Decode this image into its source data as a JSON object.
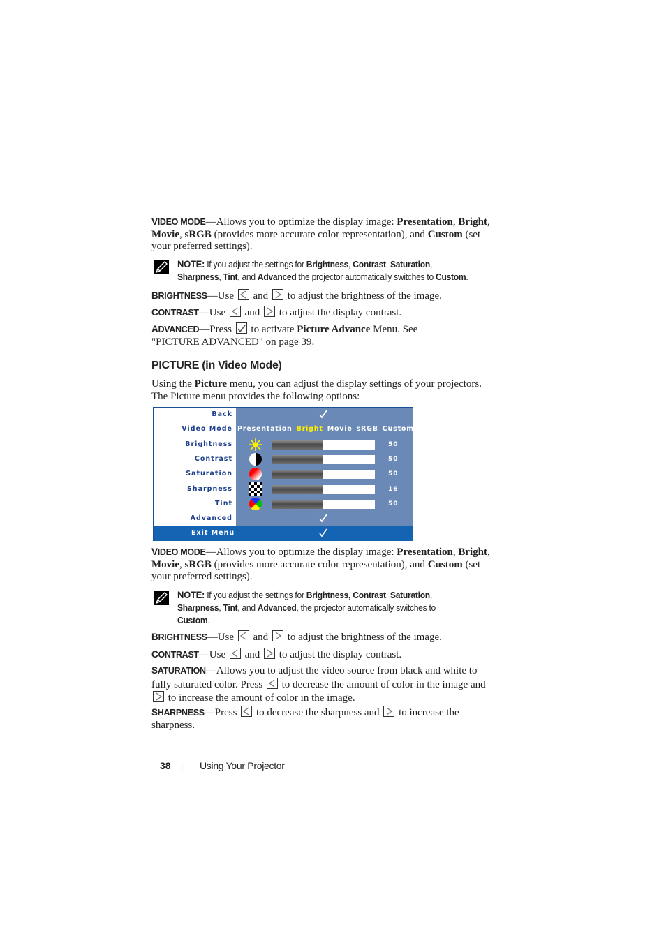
{
  "section1": {
    "video_mode": [
      {
        "sc": "Video mode"
      },
      {
        "t": "—Allows you to optimize the display image: "
      },
      {
        "b": "Presentation"
      },
      {
        "t": ", "
      },
      {
        "b": "Bright"
      },
      {
        "t": ", "
      },
      {
        "b": "Movie"
      },
      {
        "t": ", "
      },
      {
        "b": "sRGB"
      },
      {
        "t": " (provides more accurate color representation), and "
      },
      {
        "b": "Custom"
      },
      {
        "t": " (set your preferred settings)."
      }
    ],
    "note": [
      {
        "lead": "NOTE:"
      },
      {
        "t": " If you adjust the settings for "
      },
      {
        "b": "Brightness"
      },
      {
        "t": ", "
      },
      {
        "b": "Contrast"
      },
      {
        "t": ", "
      },
      {
        "b": "Saturation"
      },
      {
        "t": ","
      },
      {
        "br": true
      },
      {
        "b": "Sharpness"
      },
      {
        "t": ", "
      },
      {
        "b": "Tint"
      },
      {
        "t": ", and "
      },
      {
        "b": "Advanced"
      },
      {
        "t": " the projector automatically switches to "
      },
      {
        "b": "Custom"
      },
      {
        "t": "."
      }
    ],
    "brightness": [
      {
        "sc": "Brightness"
      },
      {
        "t": "—Use "
      },
      {
        "key": "left"
      },
      {
        "t": " and "
      },
      {
        "key": "right"
      },
      {
        "t": " to adjust the brightness of the image."
      }
    ],
    "contrast": [
      {
        "sc": "Contrast"
      },
      {
        "t": "—Use "
      },
      {
        "key": "left"
      },
      {
        "t": " and "
      },
      {
        "key": "right"
      },
      {
        "t": " to adjust the display contrast."
      }
    ],
    "advanced": [
      {
        "sc": "Advanced"
      },
      {
        "t": "—Press "
      },
      {
        "key": "check"
      },
      {
        "t": " to activate "
      },
      {
        "b": "Picture Advance"
      },
      {
        "t": " Menu. See \"PICTURE ADVANCED\" on page 39."
      }
    ]
  },
  "heading": "PICTURE (in Video Mode)",
  "intro": [
    {
      "t": "Using the "
    },
    {
      "b": "Picture"
    },
    {
      "t": " menu, you can adjust the display settings of your projectors. The Picture menu provides the following options:"
    }
  ],
  "osd_menu": {
    "rows": [
      {
        "label": "Back",
        "type": "check"
      },
      {
        "label": "Video Mode",
        "type": "modes"
      },
      {
        "label": "Brightness",
        "type": "slider",
        "icon": "brightness-sun-icon",
        "value": "50",
        "fill": 0.49
      },
      {
        "label": "Contrast",
        "type": "slider",
        "icon": "contrast-circle-icon",
        "value": "50",
        "fill": 0.49
      },
      {
        "label": "Saturation",
        "type": "slider",
        "icon": "saturation-icon",
        "value": "50",
        "fill": 0.49
      },
      {
        "label": "Sharpness",
        "type": "slider",
        "icon": "sharpness-checker-icon",
        "value": "16",
        "fill": 0.49
      },
      {
        "label": "Tint",
        "type": "slider",
        "icon": "tint-color-wheel-icon",
        "value": "50",
        "fill": 0.49
      },
      {
        "label": "Advanced",
        "type": "check"
      },
      {
        "label": "Exit Menu",
        "type": "exit"
      }
    ],
    "modes": [
      "Presentation",
      "Bright",
      "Movie",
      "sRGB",
      "Custom"
    ],
    "selected_mode": "Bright",
    "colors": {
      "panel": "#6b89b6",
      "exit": "#1563b3",
      "label": "#1d3f8c",
      "selected_mode": "#ffee00"
    }
  },
  "section2": {
    "video_mode": [
      {
        "sc": "Video mode"
      },
      {
        "t": "—Allows you to optimize the display image: "
      },
      {
        "b": "Presentation"
      },
      {
        "t": ", "
      },
      {
        "b": "Bright"
      },
      {
        "t": ", "
      },
      {
        "b": "Movie"
      },
      {
        "t": ", "
      },
      {
        "b": "sRGB"
      },
      {
        "t": " (provides more accurate color representation), and "
      },
      {
        "b": "Custom"
      },
      {
        "t": " (set your preferred settings)."
      }
    ],
    "note": [
      {
        "lead": "NOTE:"
      },
      {
        "t": " If you adjust the settings for "
      },
      {
        "b": "Brightness, Contrast"
      },
      {
        "t": ", "
      },
      {
        "b": "Saturation"
      },
      {
        "t": ","
      },
      {
        "br": true
      },
      {
        "b": "Sharpness"
      },
      {
        "t": ", "
      },
      {
        "b": "Tint"
      },
      {
        "t": ", and "
      },
      {
        "b": "Advanced"
      },
      {
        "t": ", the projector automatically switches to"
      },
      {
        "br": true
      },
      {
        "b": "Custom"
      },
      {
        "t": "."
      }
    ],
    "brightness": [
      {
        "sc": "Brightness"
      },
      {
        "t": "—Use "
      },
      {
        "key": "left"
      },
      {
        "t": " and "
      },
      {
        "key": "right"
      },
      {
        "t": " to adjust the brightness of the image."
      }
    ],
    "contrast": [
      {
        "sc": "Contrast"
      },
      {
        "t": "—Use "
      },
      {
        "key": "left"
      },
      {
        "t": " and "
      },
      {
        "key": "right"
      },
      {
        "t": " to adjust the display contrast."
      }
    ],
    "saturation": [
      {
        "sc": "Saturation"
      },
      {
        "t": "—Allows you to adjust the video source from black and white to fully saturated color. Press "
      },
      {
        "key": "left"
      },
      {
        "t": " to decrease the amount of color in the image and "
      },
      {
        "key": "right"
      },
      {
        "t": " to increase the amount of color in the image."
      }
    ],
    "sharpness": [
      {
        "sc": "Sharpness"
      },
      {
        "t": "—Press "
      },
      {
        "key": "left"
      },
      {
        "t": " to decrease the sharpness and "
      },
      {
        "key": "right"
      },
      {
        "t": " to increase the sharpness."
      }
    ]
  },
  "footer": {
    "page_number": "38",
    "separator": "|",
    "section": "Using Your Projector"
  }
}
